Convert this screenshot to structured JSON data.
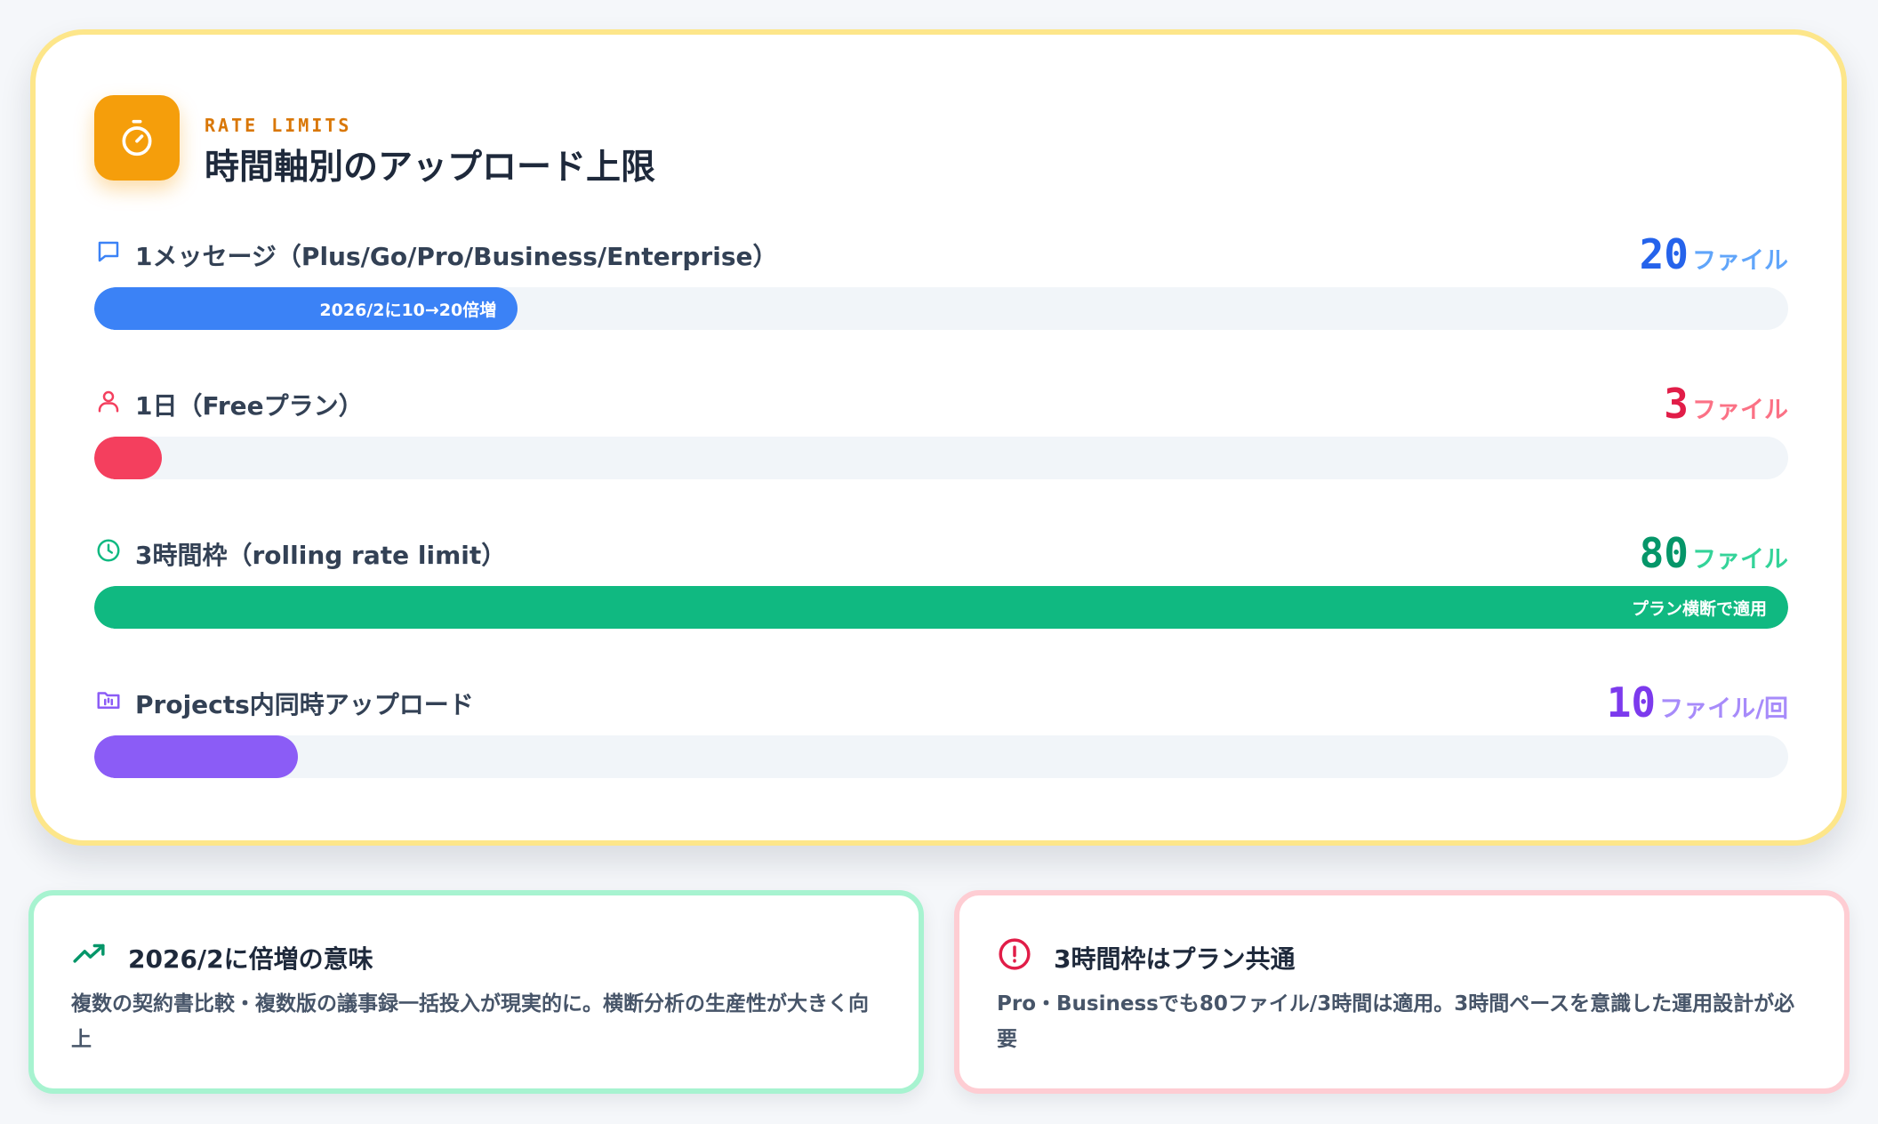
{
  "header": {
    "eyebrow": "RATE LIMITS",
    "title": "時間軸別のアップロード上限",
    "icon": "stopwatch-icon",
    "accent": "#f59e0b"
  },
  "limits": [
    {
      "label": "1メッセージ（Plus/Go/Pro/Business/Enterprise）",
      "value": "20",
      "unit": "ファイル",
      "bar_label": "2026/2に10→20倍増",
      "level_pct": 25,
      "icon": "message-icon",
      "color": "#3b82f6",
      "value_color": "#2563eb",
      "unit_color": "#60a5fa"
    },
    {
      "label": "1日（Freeプラン）",
      "value": "3",
      "unit": "ファイル",
      "bar_label": "",
      "level_pct": 4,
      "icon": "user-icon",
      "color": "#f43f5e",
      "value_color": "#e11d48",
      "unit_color": "#fb7185"
    },
    {
      "label": "3時間枠（rolling rate limit）",
      "value": "80",
      "unit": "ファイル",
      "bar_label": "プラン横断で適用",
      "level_pct": 100,
      "icon": "clock-icon",
      "color": "#10b981",
      "value_color": "#059669",
      "unit_color": "#34d399"
    },
    {
      "label": "Projects内同時アップロード",
      "value": "10",
      "unit": "ファイル/回",
      "bar_label": "",
      "level_pct": 12,
      "icon": "folder-icon",
      "color": "#8b5cf6",
      "value_color": "#7c3aed",
      "unit_color": "#a78bfa"
    }
  ],
  "notes": [
    {
      "title": "2026/2に倍増の意味",
      "body": "複数の契約書比較・複数版の議事録一括投入が現実的に。横断分析の生産性が大きく向上",
      "icon": "trending-up-icon",
      "color": "#059669"
    },
    {
      "title": "3時間枠はプラン共通",
      "body": "Pro・Businessでも80ファイル/3時間は適用。3時間ペースを意識した運用設計が必要",
      "icon": "alert-circle-icon",
      "color": "#e11d48"
    }
  ]
}
